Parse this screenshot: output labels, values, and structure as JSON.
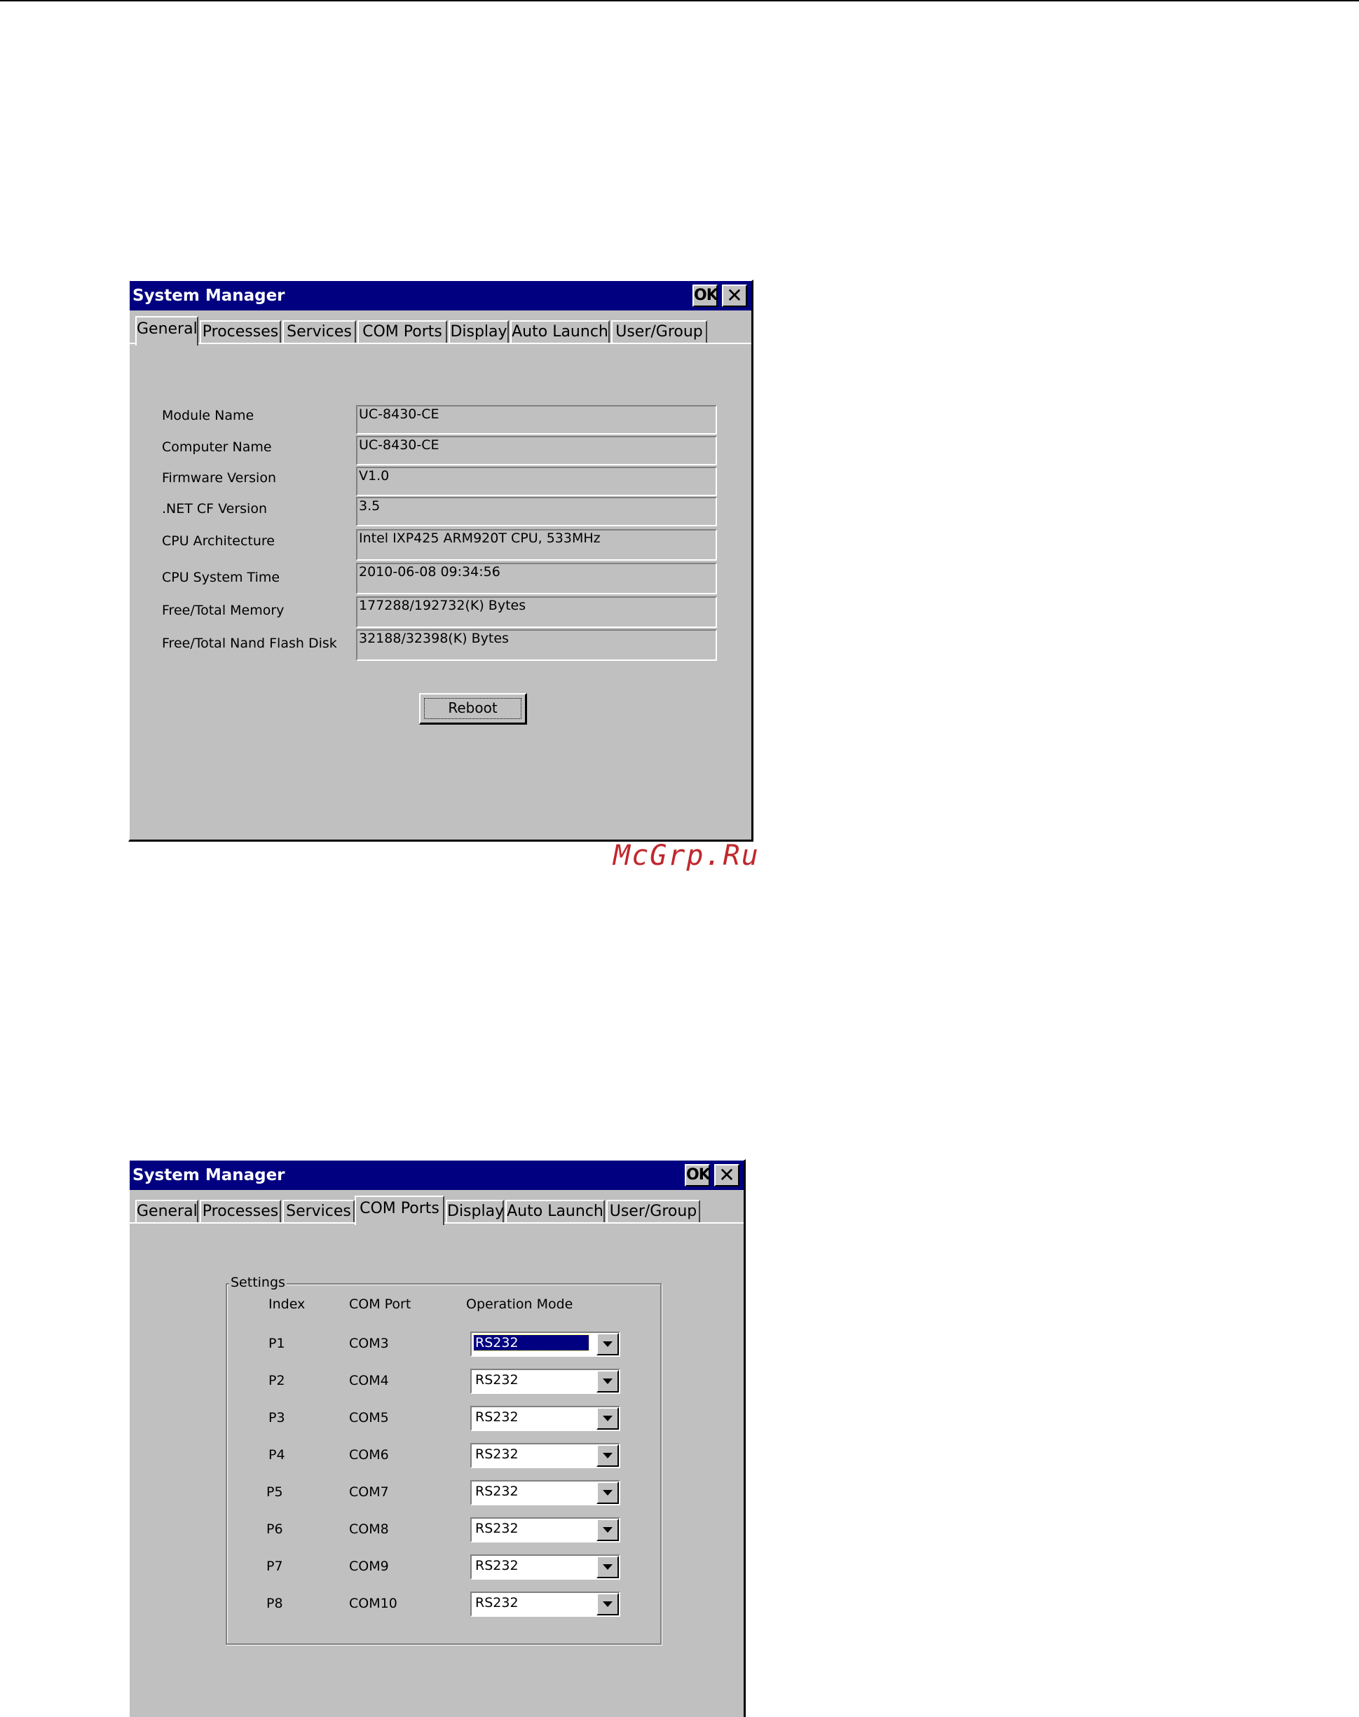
{
  "watermark": "McGrp.Ru",
  "window1": {
    "title": "System Manager",
    "ok_label": "OK",
    "close_label": "✕",
    "tabs": [
      "General",
      "Processes",
      "Services",
      "COM Ports",
      "Display",
      "Auto Launch",
      "User/Group"
    ],
    "active_tab": "General",
    "fields": [
      {
        "label": "Module Name",
        "value": "UC-8430-CE"
      },
      {
        "label": "Computer Name",
        "value": "UC-8430-CE"
      },
      {
        "label": "Firmware Version",
        "value": "V1.0"
      },
      {
        "label": ".NET CF Version",
        "value": "3.5"
      },
      {
        "label": "CPU Architecture",
        "value": "Intel IXP425 ARM920T CPU, 533MHz"
      },
      {
        "label": "CPU System Time",
        "value": "2010-06-08 09:34:56"
      },
      {
        "label": "Free/Total Memory",
        "value": "177288/192732(K) Bytes"
      },
      {
        "label": "Free/Total Nand Flash Disk",
        "value": "32188/32398(K) Bytes"
      }
    ],
    "reboot_label": "Reboot"
  },
  "window2": {
    "title": "System Manager",
    "ok_label": "OK",
    "close_label": "✕",
    "tabs": [
      "General",
      "Processes",
      "Services",
      "COM Ports",
      "Display",
      "Auto Launch",
      "User/Group"
    ],
    "active_tab": "COM Ports",
    "group_title": "Settings",
    "headers": {
      "index": "Index",
      "port": "COM Port",
      "mode": "Operation Mode"
    },
    "rows": [
      {
        "index": "P1",
        "port": "COM3",
        "mode": "RS232"
      },
      {
        "index": "P2",
        "port": "COM4",
        "mode": "RS232"
      },
      {
        "index": "P3",
        "port": "COM5",
        "mode": "RS232"
      },
      {
        "index": "P4",
        "port": "COM6",
        "mode": "RS232"
      },
      {
        "index": "P5",
        "port": "COM7",
        "mode": "RS232"
      },
      {
        "index": "P6",
        "port": "COM8",
        "mode": "RS232"
      },
      {
        "index": "P7",
        "port": "COM9",
        "mode": "RS232"
      },
      {
        "index": "P8",
        "port": "COM10",
        "mode": "RS232"
      }
    ]
  }
}
